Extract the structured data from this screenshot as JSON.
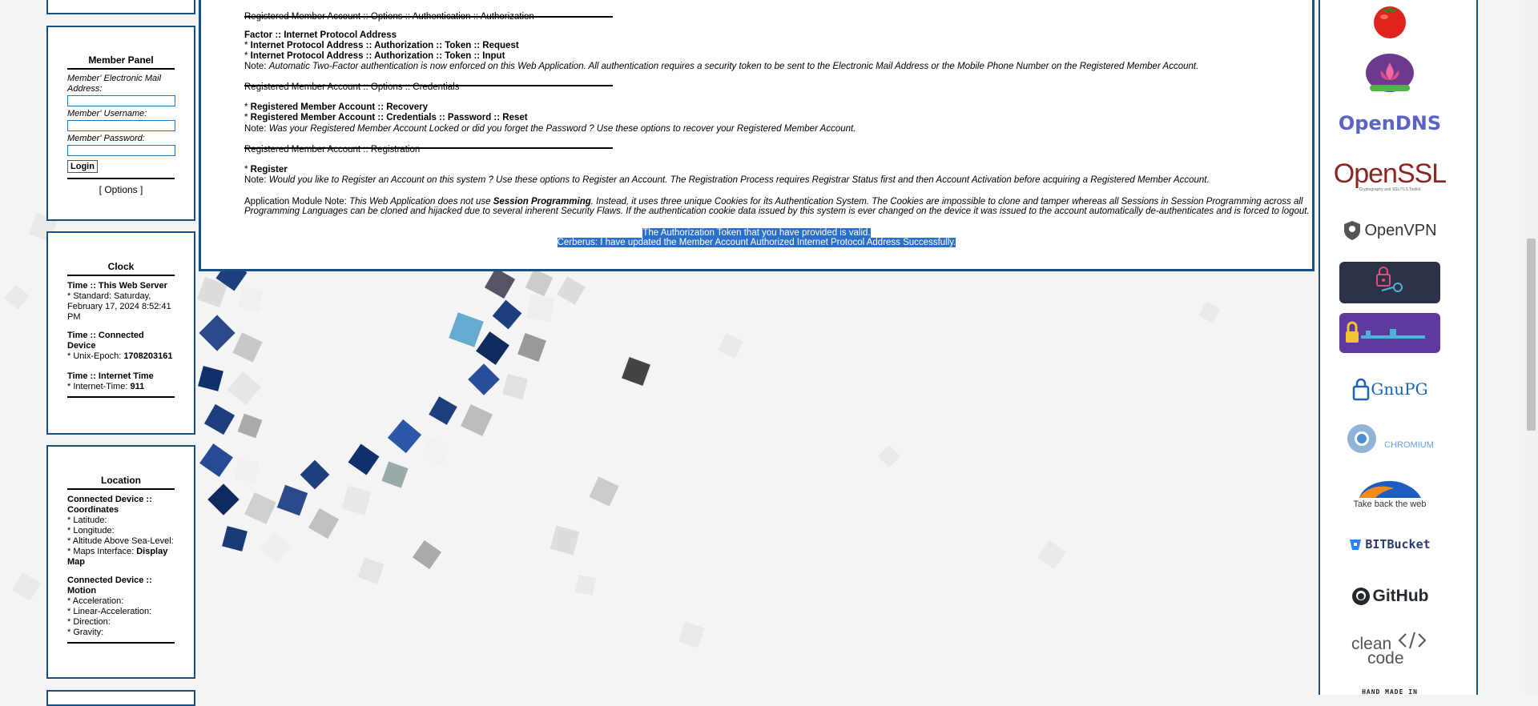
{
  "member_panel": {
    "title": "Member Panel",
    "email_label": "Member' Electronic Mail Address:",
    "username_label": "Member' Username:",
    "password_label": "Member' Password:",
    "login_button": "Login",
    "options_open": "[ ",
    "options_link": "Options",
    "options_close": " ]"
  },
  "clock": {
    "title": "Clock",
    "server_head": "Time :: This Web Server",
    "server_value": "* Standard: Saturday, February 17, 2024 8:52:41 PM",
    "device_head": "Time :: Connected Device",
    "epoch_label": "* Unix-Epoch: ",
    "epoch_value": "1708203161",
    "internet_head": "Time :: Internet Time",
    "internet_label": "* Internet-Time: ",
    "internet_value": "911"
  },
  "location": {
    "title": "Location",
    "coords_head": "Connected Device :: Coordinates",
    "latitude": "* Latitude:",
    "longitude": "* Longitude:",
    "altitude": "* Altitude Above Sea-Level:",
    "maps_label": "* Maps Interface: ",
    "maps_link": "Display Map",
    "motion_head": "Connected Device :: Motion",
    "acceleration": "* Acceleration:",
    "linear_acceleration": "* Linear-Acceleration:",
    "direction": "* Direction:",
    "gravity": "* Gravity:"
  },
  "main": {
    "auth_header": "Registered Member Account :: Options :: Authentication :: Authorization",
    "factor_head": "Factor :: Internet Protocol Address",
    "token_request": "Internet Protocol Address :: Authorization :: Token :: Request",
    "token_input": "Internet Protocol Address :: Authorization :: Token :: Input",
    "note_label": "Note: ",
    "auth_note": "Automatic Two-Factor authentication is now enforced on this Web Application. All authentication requires a security token to be sent to the Electronic Mail Address or the Mobile Phone Number on the Registered Member Account.",
    "cred_header": "Registered Member Account :: Options :: Credentials",
    "recovery": "Registered Member Account :: Recovery",
    "reset": "Registered Member Account :: Credentials :: Password :: Reset",
    "cred_note": "Was your Registered Member Account Locked or did you forget the Password ? Use these options to recover your Registered Member Account.",
    "reg_header": "Registered Member Account :: Registration",
    "register": "Register",
    "reg_note": "Would you like to Register an Account on this system ? Use these options to Register an Account. The Registration Process requires Registrar Status first and then Account Activation before acquiring a Registered Member Account.",
    "module_note_label": "Application Module Note: ",
    "module_note_1": "This Web Application does not use ",
    "module_note_bold": "Session Programming",
    "module_note_2": ". Instead, it uses three unique Cookies for its Authentication System. The Cookies are impossible to clone and tamper whereas all Sessions in Session Programming across all",
    "module_note_3": "Programming Languages can be cloned and hijacked due to several inherent Security Flaws. If the authentication cookie data issued by this system is ever changed on the device it was issued to the account automatically de-authenticates and is forced to logout.",
    "msg_valid": "The Authorization Token that you have provided is valid.",
    "msg_updated": "Cerberus: I have updated the Member Account Authorized Internet Protocol Address Successfully."
  },
  "sidebar_logos": {
    "opendns": "OpenDNS",
    "openssl": "OpenSSL",
    "openssl_sub": "Cryptography and SSL/TLS Toolkit",
    "openvpn": "OpenVPN",
    "gnupg": "GnuPG",
    "chromium": "CHROMIUM",
    "takeback": "Take back the web",
    "bitbucket": "BITBucket",
    "github": "GitHub",
    "cleancode_1": "clean",
    "cleancode_2": "code",
    "handmade": "HAND MADE IN"
  },
  "colors": {
    "border": "#1b4f80",
    "highlight": "#2a70c8"
  }
}
